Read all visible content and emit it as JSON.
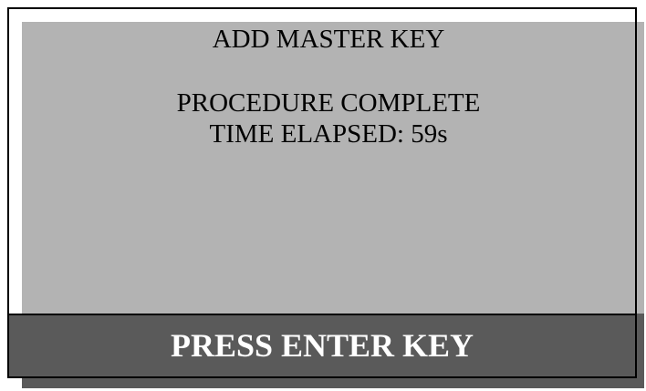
{
  "screen": {
    "title": "ADD MASTER KEY",
    "status": "PROCEDURE COMPLETE",
    "time_elapsed": "TIME ELAPSED: 59s",
    "prompt": "PRESS ENTER KEY"
  },
  "colors": {
    "display_background": "#b3b3b3",
    "prompt_background": "#5a5a5a",
    "prompt_text": "#ffffff",
    "text": "#000000"
  }
}
